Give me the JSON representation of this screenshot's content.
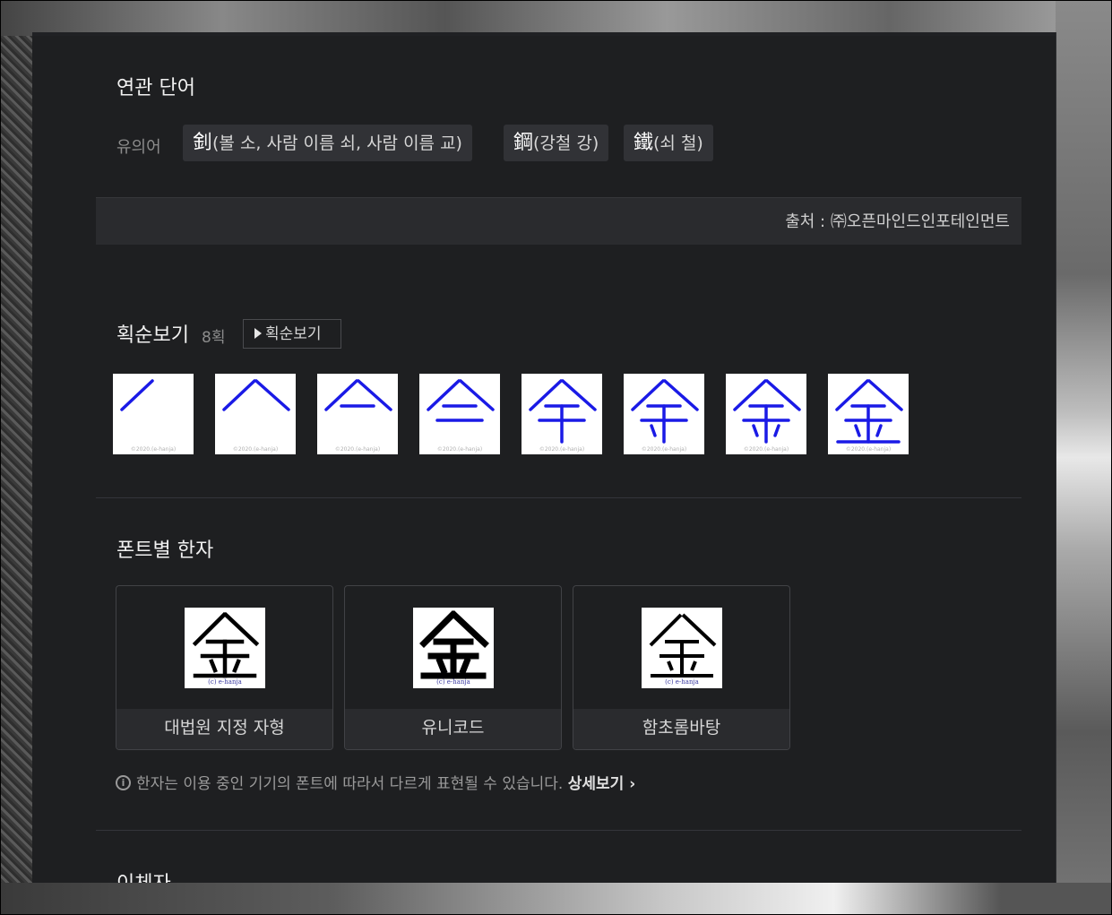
{
  "related": {
    "title": "연관 단어",
    "synonym_label": "유의어",
    "synonyms": [
      {
        "hanja": "釗",
        "reading": "(볼 소, 사람 이름 쇠, 사람 이름 교)"
      },
      {
        "hanja": "鋼",
        "reading": "(강철 강)"
      },
      {
        "hanja": "鐵",
        "reading": "(쇠 철)"
      }
    ],
    "source": "출처 : ㈜오픈마인드인포테인먼트"
  },
  "stroke": {
    "title": "획순보기",
    "count": "8획",
    "button_label": "획순보기",
    "watermark": "©2020.(e-hanja)",
    "color": "#1a1ae6"
  },
  "fonts": {
    "title": "폰트별 한자",
    "character": "金",
    "watermark": "(c) e-hanja",
    "cards": [
      {
        "caption": "대법원 지정 자형"
      },
      {
        "caption": "유니코드"
      },
      {
        "caption": "함초롬바탕"
      }
    ],
    "info_text": "한자는 이용 중인 기기의 폰트에 따라서 다르게 표현될 수 있습니다.",
    "info_more": "상세보기",
    "info_icon": "i"
  },
  "variants": {
    "title": "이체자"
  }
}
